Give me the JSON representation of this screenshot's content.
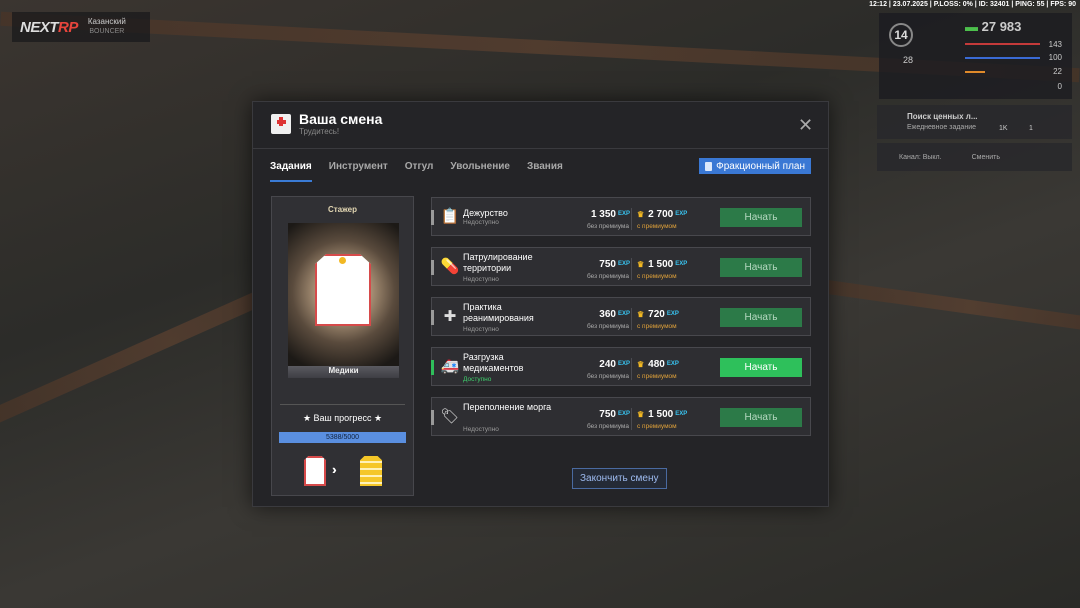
{
  "hud": {
    "brand_prefix": "NEXT",
    "brand_suffix": "RP",
    "server_name": "Казанский",
    "server_sub": "BOUNCER",
    "topline": "12:12 | 23.07.2025 | P.LOSS: 0% | ID: 32401 | PING: 55 | FPS: 90",
    "level": "14",
    "money": "27 983",
    "health": "143",
    "armor": "100",
    "hunger": "22",
    "wanted": "0",
    "cash2": "28",
    "quest_title": "Поиск ценных л...",
    "quest_sub": "Ежедневное задание",
    "quest_count1": "1K",
    "quest_count2": "1",
    "channel_label": "Канал: Выкл.",
    "channel_change": "Сменить"
  },
  "modal": {
    "title": "Ваша смена",
    "subtitle": "Трудитесь!",
    "tabs": [
      "Задания",
      "Инструмент",
      "Отгул",
      "Увольнение",
      "Звания"
    ],
    "faction_plan": "Фракционный план",
    "rank": "Стажер",
    "card_label": "Медики",
    "progress_title": "★ Ваш прогресс ★",
    "progress_text": "5388/5000",
    "progress_fraction": 1.0,
    "tasks": [
      {
        "name": "Дежурство",
        "status": "Недоступно",
        "available": false,
        "v1": "1 350",
        "v2": "2 700",
        "icon": "clipboard-icon"
      },
      {
        "name": "Патрулирование территории",
        "status": "Недоступно",
        "available": false,
        "v1": "750",
        "v2": "1 500",
        "icon": "pills-icon"
      },
      {
        "name": "Практика реанимирования",
        "status": "Недоступно",
        "available": false,
        "v1": "360",
        "v2": "720",
        "icon": "resuscitation-icon"
      },
      {
        "name": "Разгрузка медикаментов",
        "status": "Доступно",
        "available": true,
        "v1": "240",
        "v2": "480",
        "icon": "ambulance-icon"
      },
      {
        "name": "Переполнение морга",
        "status": "Недоступно",
        "available": false,
        "v1": "750",
        "v2": "1 500",
        "icon": "foot-tag-icon"
      }
    ],
    "exp_label": "EXP",
    "no_premium": "без премиума",
    "with_premium": "с премиумом",
    "start_label": "Начать",
    "finish_label": "Закончить смену"
  }
}
